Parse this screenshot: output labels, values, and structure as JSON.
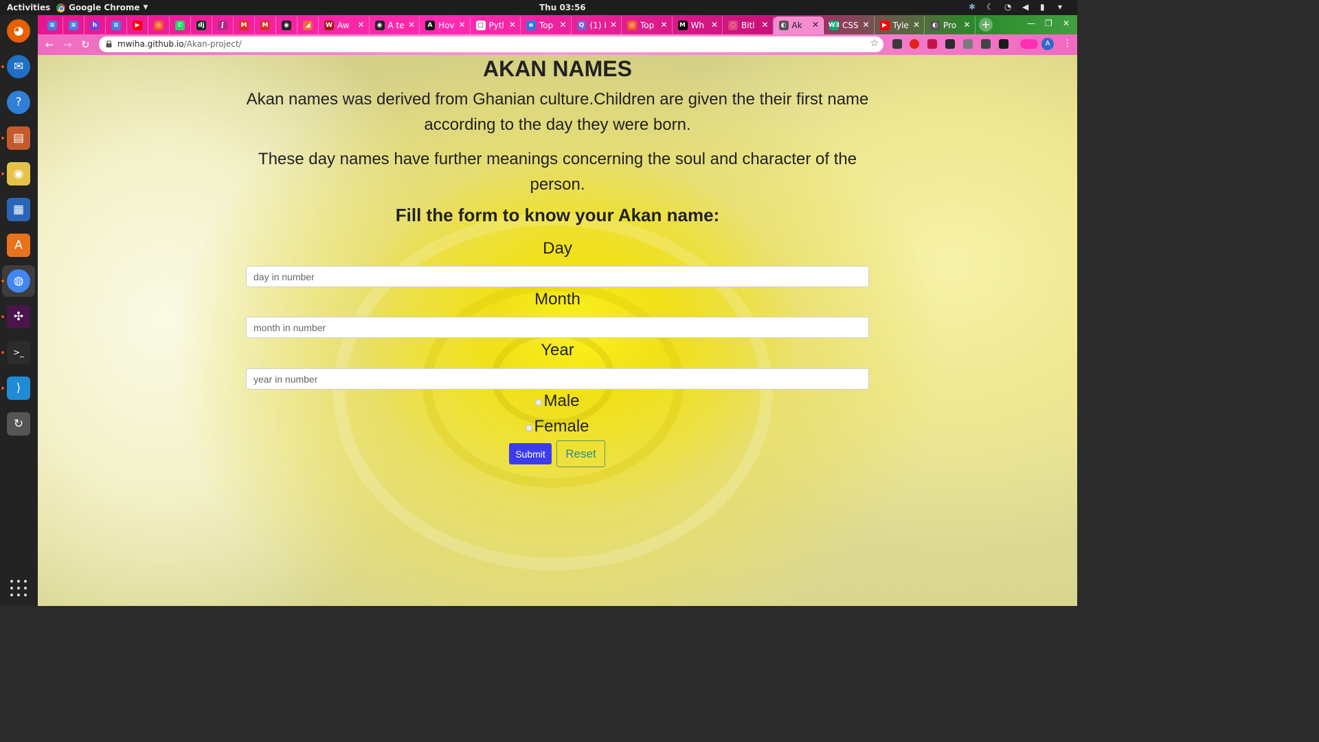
{
  "system": {
    "activities_label": "Activities",
    "app_name": "Google Chrome",
    "clock": "Thu 03:56"
  },
  "dock": {
    "items": [
      {
        "name": "firefox",
        "color": "#e66000"
      },
      {
        "name": "thunderbird",
        "color": "#1f6fc5"
      },
      {
        "name": "help",
        "color": "#2f7fd6"
      },
      {
        "name": "files",
        "color": "#c45a2c"
      },
      {
        "name": "rhythmbox",
        "color": "#e5c34a"
      },
      {
        "name": "writer",
        "color": "#2a66b8"
      },
      {
        "name": "software",
        "color": "#e8731c"
      },
      {
        "name": "chrome",
        "color": "#4285f4"
      },
      {
        "name": "slack",
        "color": "#4a154b"
      },
      {
        "name": "terminal",
        "color": "#2c2c2c"
      },
      {
        "name": "vscode",
        "color": "#1f8ad6"
      },
      {
        "name": "updater",
        "color": "#555555"
      }
    ]
  },
  "browser": {
    "tabs": [
      {
        "label": "",
        "fav": "≡",
        "fav_bg": "#4a7be0"
      },
      {
        "label": "",
        "fav": "≡",
        "fav_bg": "#4a7be0"
      },
      {
        "label": "",
        "fav": "h",
        "fav_bg": "#7a3fd0"
      },
      {
        "label": "",
        "fav": "≡",
        "fav_bg": "#4a7be0"
      },
      {
        "label": "",
        "fav": "▶",
        "fav_bg": "#ff0000"
      },
      {
        "label": "",
        "fav": "◎",
        "fav_bg": "#f05a28"
      },
      {
        "label": "",
        "fav": "✆",
        "fav_bg": "#25d366"
      },
      {
        "label": "",
        "fav": "dj",
        "fav_bg": "#092e20"
      },
      {
        "label": "",
        "fav": "ʃ",
        "fav_bg": "#b02a8a"
      },
      {
        "label": "",
        "fav": "M",
        "fav_bg": "#d93025"
      },
      {
        "label": "",
        "fav": "M",
        "fav_bg": "#d93025"
      },
      {
        "label": "",
        "fav": "◉",
        "fav_bg": "#222222"
      },
      {
        "label": "",
        "fav": "◢",
        "fav_bg": "#f26b3a"
      },
      {
        "label": "Aw",
        "fav": "W",
        "fav_bg": "#a31d1d"
      },
      {
        "label": "A te",
        "fav": "◉",
        "fav_bg": "#222222"
      },
      {
        "label": "Hov",
        "fav": "A",
        "fav_bg": "#111111"
      },
      {
        "label": "Pytl",
        "fav": "□",
        "fav_bg": "#ffffff"
      },
      {
        "label": "Top",
        "fav": "e",
        "fav_bg": "#2a7ae2"
      },
      {
        "label": "(1) I",
        "fav": "Q",
        "fav_bg": "#7a5cd0"
      },
      {
        "label": "Top",
        "fav": "◎",
        "fav_bg": "#f05a28"
      },
      {
        "label": "Wh",
        "fav": "M",
        "fav_bg": "#000000"
      },
      {
        "label": "Bitl",
        "fav": "◌",
        "fav_bg": "#e0447a"
      },
      {
        "label": "Ak",
        "fav": "◐",
        "fav_bg": "#555555"
      },
      {
        "label": "CSS",
        "fav": "W3",
        "fav_bg": "#04aa6d"
      },
      {
        "label": "Tyle",
        "fav": "▶",
        "fav_bg": "#ff0000"
      },
      {
        "label": "Pro",
        "fav": "◐",
        "fav_bg": "#555555"
      }
    ],
    "active_tab_index": 22,
    "url_host": "mwiha.github.io",
    "url_path": "/Akan-project/"
  },
  "page": {
    "title": "AKAN NAMES",
    "intro_1": "Akan names was derived from Ghanian culture.Children are given the their first name according to the day they were born.",
    "intro_2": "These day names have further meanings concerning the soul and character of the person.",
    "form_heading": "Fill the form to know your Akan name:",
    "day_label": "Day",
    "day_placeholder": "day in number",
    "month_label": "Month",
    "month_placeholder": "month in number",
    "year_label": "Year",
    "year_placeholder": "year in number",
    "male_label": "Male",
    "female_label": "Female",
    "submit_label": "Submit",
    "reset_label": "Reset"
  }
}
